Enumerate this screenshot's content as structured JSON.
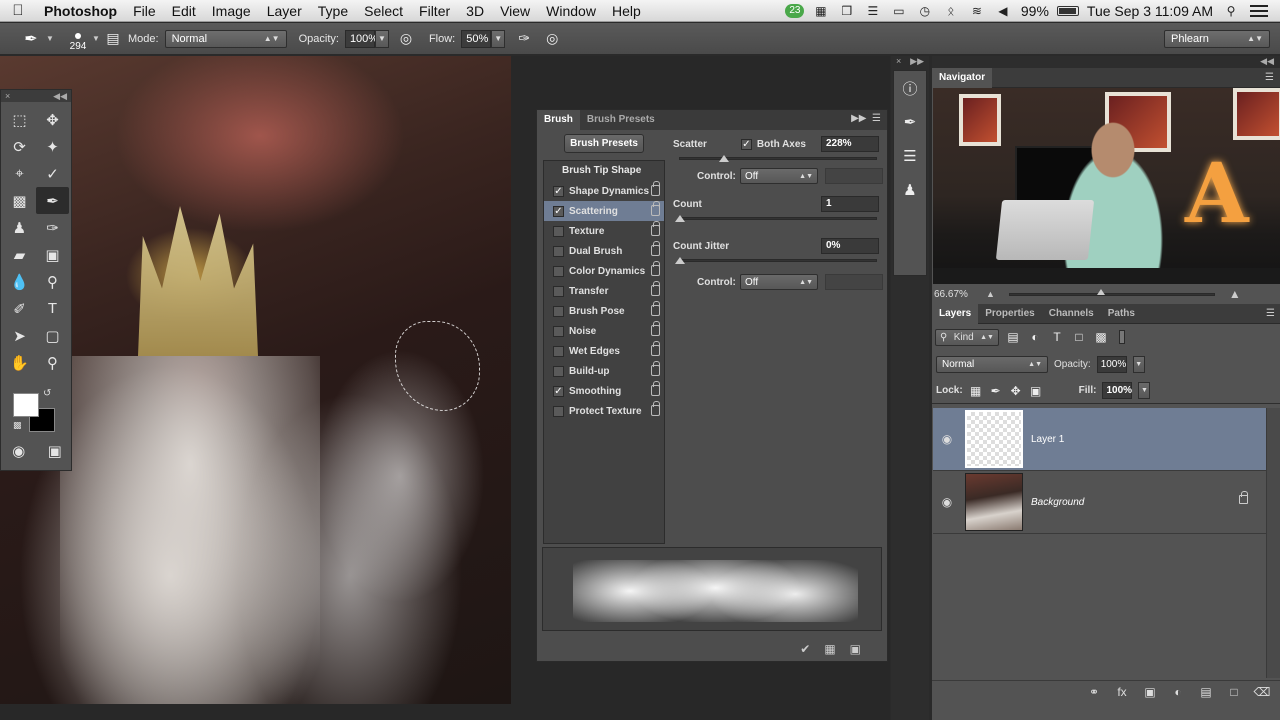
{
  "menubar": {
    "apple": "",
    "app": "Photoshop",
    "items": [
      "File",
      "Edit",
      "Image",
      "Layer",
      "Type",
      "Select",
      "Filter",
      "3D",
      "View",
      "Window",
      "Help"
    ],
    "badge": "23",
    "battery": "99%",
    "datetime": "Tue Sep 3  11:09 AM"
  },
  "options": {
    "brush_size": "294",
    "mode_label": "Mode:",
    "mode_value": "Normal",
    "opacity_label": "Opacity:",
    "opacity_value": "100%",
    "flow_label": "Flow:",
    "flow_value": "50%",
    "workspace": "Phlearn"
  },
  "brush_panel": {
    "tabs": [
      "Brush",
      "Brush Presets"
    ],
    "presets_button": "Brush Presets",
    "list_head": "Brush Tip Shape",
    "items": [
      {
        "label": "Shape Dynamics",
        "checked": true
      },
      {
        "label": "Scattering",
        "checked": true
      },
      {
        "label": "Texture",
        "checked": false
      },
      {
        "label": "Dual Brush",
        "checked": false
      },
      {
        "label": "Color Dynamics",
        "checked": false
      },
      {
        "label": "Transfer",
        "checked": false
      },
      {
        "label": "Brush Pose",
        "checked": false
      },
      {
        "label": "Noise",
        "checked": false
      },
      {
        "label": "Wet Edges",
        "checked": false
      },
      {
        "label": "Build-up",
        "checked": false
      },
      {
        "label": "Smoothing",
        "checked": true
      },
      {
        "label": "Protect Texture",
        "checked": false
      }
    ],
    "scatter_label": "Scatter",
    "both_axes_label": "Both Axes",
    "scatter_value": "228%",
    "control_label": "Control:",
    "control1_value": "Off",
    "count_label": "Count",
    "count_value": "1",
    "count_jitter_label": "Count Jitter",
    "count_jitter_value": "0%",
    "control2_value": "Off"
  },
  "navigator": {
    "tab": "Navigator",
    "zoom": "66.67%"
  },
  "layers_panel": {
    "tabs": [
      "Layers",
      "Properties",
      "Channels",
      "Paths"
    ],
    "kind_label": "Kind",
    "blend_mode": "Normal",
    "opacity_label": "Opacity:",
    "opacity_value": "100%",
    "lock_label": "Lock:",
    "fill_label": "Fill:",
    "fill_value": "100%",
    "layers": [
      {
        "name": "Layer 1",
        "selected": true
      },
      {
        "name": "Background",
        "selected": false
      }
    ]
  }
}
